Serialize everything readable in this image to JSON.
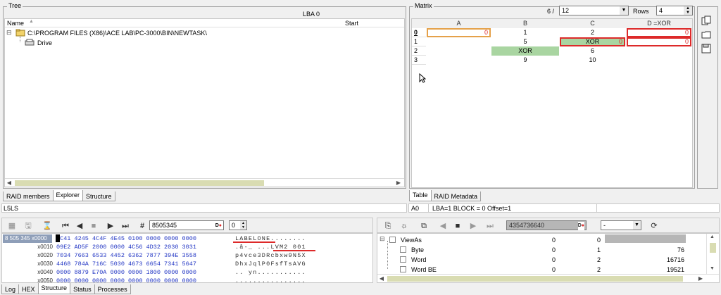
{
  "tree": {
    "title": "Tree",
    "lba_label": "LBA 0",
    "col_name": "Name",
    "col_start": "Start",
    "root_path": "C:\\PROGRAM FILES (X86)\\ACE LAB\\PC-3000\\BIN\\NEWTASK\\",
    "child": "Drive",
    "collapse_glyph": "⊟"
  },
  "left_tabs": [
    "RAID members",
    "Explorer",
    "Structure"
  ],
  "left_status": "L5LS",
  "matrix": {
    "title": "Matrix",
    "position": "6 /",
    "select_value": "12",
    "rows_label": "Rows",
    "rows_value": "4",
    "columns": [
      "A",
      "B",
      "C",
      "D =XOR"
    ],
    "row_headers": [
      "0",
      "1",
      "2",
      "3"
    ],
    "rows": [
      [
        "0",
        "1",
        "2",
        "0"
      ],
      [
        "",
        "5",
        "XOR",
        "0"
      ],
      [
        "",
        "XOR",
        "6",
        ""
      ],
      [
        "",
        "9",
        "10",
        ""
      ]
    ],
    "inner_zero": "0"
  },
  "right_tabs": [
    "Table",
    "RAID Metadata"
  ],
  "right_status": {
    "a0": "A0",
    "info": "LBA=1 BLOCK = 0 Offset=1"
  },
  "hex": {
    "jump_value": "8505345",
    "spin_value": "0",
    "address_label": "8 505 345 x0000",
    "offsets": [
      "",
      "x0010",
      "x0020",
      "x0030",
      "x0040",
      "x0050"
    ],
    "bytes": [
      "4C41 4245 4C4F 4E45 0100 0000 0000 0000",
      "09E2 AD5F 2000 0000 4C56 4D32 2030 3031",
      "7034 7663 6533 4452 6362 7877 394E 3558",
      "4468 784A 716C 5030 4673 6654 7341 5647",
      "0000 8879 E70A 0000 0000 1800 0000 0000",
      "0000 0000 0000 0000 0000 0000 0000 0000"
    ],
    "ascii": [
      "LABELONE........",
      ".â-_ ...LVM2 001",
      "p4vce3DRcbxw9N5X",
      "DhxJqlP0FsfTsAVG",
      ".. yn...........",
      "................"
    ]
  },
  "bottom_tabs": [
    "Log",
    "HEX",
    "Structure",
    "Status",
    "Processes"
  ],
  "struct": {
    "value_field": "4354736640",
    "select_value": "-",
    "items": [
      {
        "name": "ViewAs",
        "c1": "0",
        "c2": "0",
        "val": "",
        "collapse": "⊟"
      },
      {
        "name": "Byte",
        "c1": "0",
        "c2": "1",
        "val": "76"
      },
      {
        "name": "Word",
        "c1": "0",
        "c2": "2",
        "val": "16716"
      },
      {
        "name": "Word BE",
        "c1": "0",
        "c2": "2",
        "val": "19521"
      }
    ]
  },
  "colors": {
    "green": "#a9d5a1",
    "red": "#dd2a2a",
    "orange": "#e5a14a",
    "thumb": "#d9dcb2",
    "hex_blue": "#2236c4",
    "sel_blue": "#3c78d8"
  }
}
